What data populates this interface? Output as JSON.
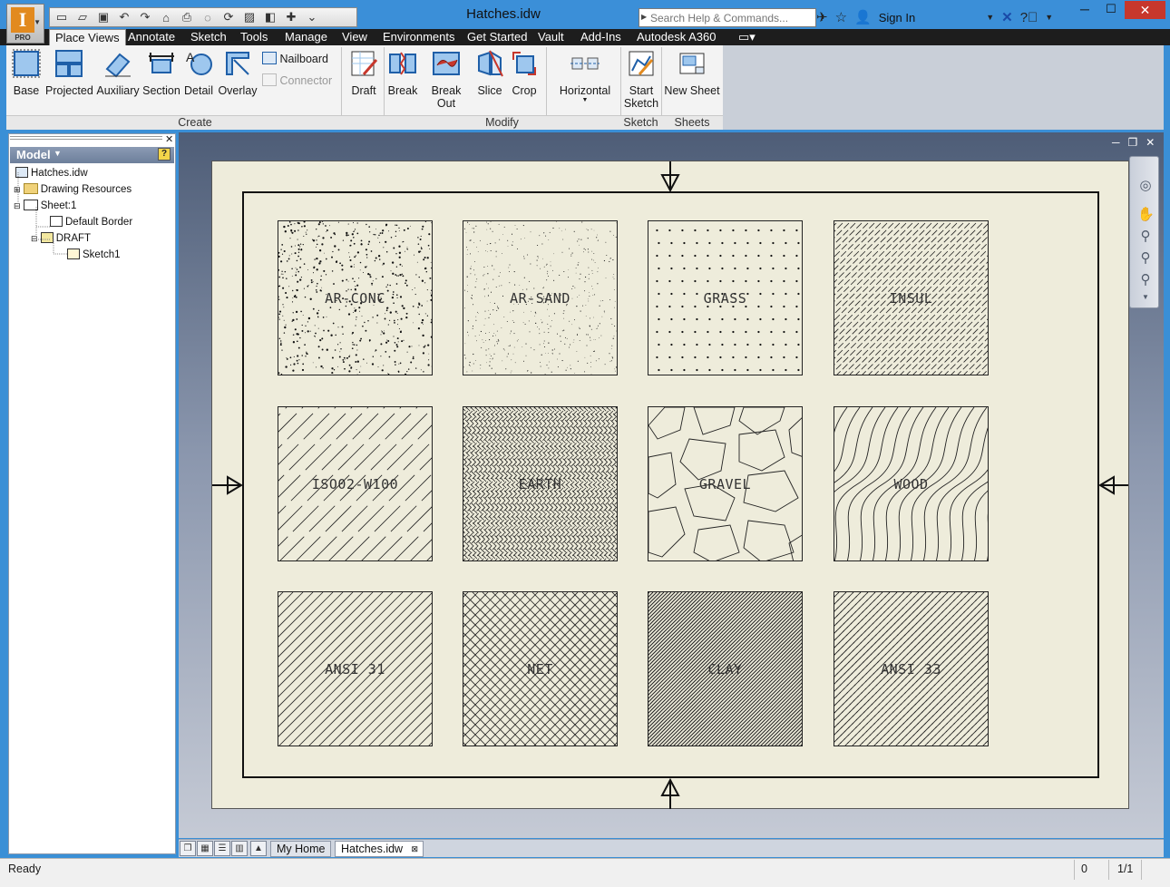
{
  "window": {
    "title": "Hatches.idw",
    "app_logo": "I",
    "app_edition": "PRO"
  },
  "search": {
    "placeholder": "Search Help & Commands..."
  },
  "account": {
    "signin_label": "Sign In"
  },
  "tabs": [
    {
      "label": "Place Views",
      "active": true
    },
    {
      "label": "Annotate"
    },
    {
      "label": "Sketch"
    },
    {
      "label": "Tools"
    },
    {
      "label": "Manage"
    },
    {
      "label": "View"
    },
    {
      "label": "Environments"
    },
    {
      "label": "Get Started"
    },
    {
      "label": "Vault"
    },
    {
      "label": "Add-Ins"
    },
    {
      "label": "Autodesk A360"
    }
  ],
  "ribbon": {
    "create": {
      "label": "Create",
      "buttons": [
        "Base",
        "Projected",
        "Auxiliary",
        "Section",
        "Detail",
        "Overlay"
      ],
      "small": [
        "Nailboard",
        "Connector"
      ],
      "draft": "Draft"
    },
    "modify": {
      "label": "Modify",
      "buttons": [
        "Break",
        "Break Out",
        "Slice",
        "Crop"
      ],
      "horizontal": "Horizontal"
    },
    "sketch": {
      "label": "Sketch",
      "button_line1": "Start",
      "button_line2": "Sketch"
    },
    "sheets": {
      "label": "Sheets",
      "button": "New Sheet"
    }
  },
  "browser": {
    "title": "Model",
    "items": [
      {
        "label": "Hatches.idw"
      },
      {
        "label": "Drawing Resources"
      },
      {
        "label": "Sheet:1"
      },
      {
        "label": "Default Border"
      },
      {
        "label": "DRAFT"
      },
      {
        "label": "Sketch1"
      }
    ]
  },
  "hatches": [
    {
      "label": "AR-CONC",
      "pattern": "conc"
    },
    {
      "label": "AR-SAND",
      "pattern": "sand"
    },
    {
      "label": "GRASS",
      "pattern": "grass"
    },
    {
      "label": "INSUL",
      "pattern": "insul"
    },
    {
      "label": "ISO02-W100",
      "pattern": "iso02"
    },
    {
      "label": "EARTH",
      "pattern": "earth"
    },
    {
      "label": "GRAVEL",
      "pattern": "gravel"
    },
    {
      "label": "WOOD",
      "pattern": "wood"
    },
    {
      "label": "ANSI 31",
      "pattern": "ansi31"
    },
    {
      "label": "NET",
      "pattern": "net"
    },
    {
      "label": "CLAY",
      "pattern": "clay"
    },
    {
      "label": "ANSI 33",
      "pattern": "ansi33"
    }
  ],
  "doc_tabs": [
    {
      "label": "My Home"
    },
    {
      "label": "Hatches.idw",
      "active": true
    }
  ],
  "status": {
    "text": "Ready",
    "count": "0",
    "page": "1/1"
  },
  "colors": {
    "titlebar": "#3b8fd8",
    "tabsbar": "#1d1d1d",
    "sheet": "#eeecdb",
    "close": "#c7372c"
  }
}
